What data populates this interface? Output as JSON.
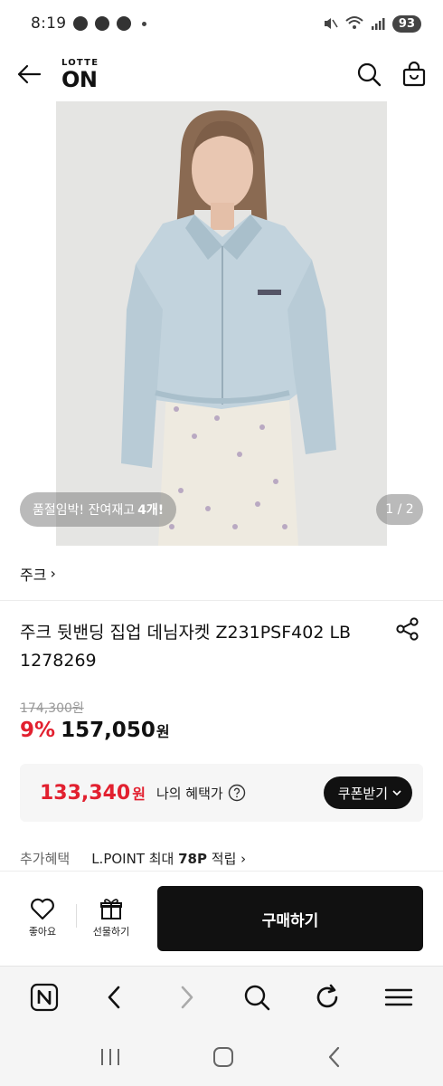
{
  "status_bar": {
    "time": "8:19",
    "battery": "93"
  },
  "header": {
    "logo_top": "LOTTE",
    "logo_bottom": "ON"
  },
  "product_image": {
    "stock_notice_prefix": "품절임박! 잔여재고 ",
    "stock_notice_count": "4개!",
    "page_indicator": "1 / 2"
  },
  "brand": {
    "name": "주크",
    "chevron": "›"
  },
  "product": {
    "title": "주크 뒷밴딩 집업 데님자켓 Z231PSF402 LB 1278269",
    "original_price": "174,300원",
    "discount": "9%",
    "price": "157,050",
    "price_unit": "원"
  },
  "benefit": {
    "price": "133,340",
    "price_unit": "원",
    "label": "나의 혜택가",
    "coupon_label": "쿠폰받기"
  },
  "extra": {
    "label": "추가혜택",
    "text_prefix": "L.POINT 최대 ",
    "text_bold": "78P",
    "text_suffix": " 적립 ›"
  },
  "actions": {
    "like_label": "좋아요",
    "gift_label": "선물하기",
    "buy_label": "구매하기"
  },
  "colors": {
    "accent_red": "#e2202f",
    "button_black": "#111111"
  }
}
